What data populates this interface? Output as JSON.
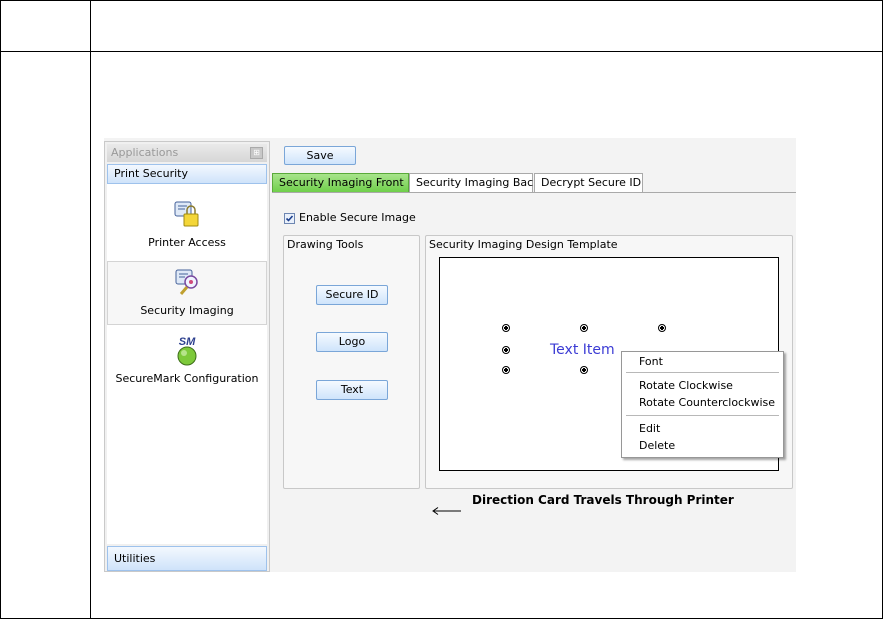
{
  "sidebar": {
    "header": "Applications",
    "sections": [
      "Print Security",
      "Utilities"
    ],
    "items": [
      {
        "label": "Printer Access",
        "icon": "lock-card-icon"
      },
      {
        "label": "Security Imaging",
        "icon": "magnifier-card-icon"
      },
      {
        "label": "SecureMark Configuration",
        "icon": "securemark-icon",
        "badge": "SM"
      }
    ]
  },
  "toolbar": {
    "save_label": "Save"
  },
  "tabs": [
    {
      "label": "Security Imaging Front",
      "active": true
    },
    {
      "label": "Security Imaging Back",
      "active": false
    },
    {
      "label": "Decrypt Secure ID",
      "active": false
    }
  ],
  "options": {
    "enable_secure_image_label": "Enable Secure Image",
    "enable_secure_image_checked": true
  },
  "drawing_tools": {
    "title": "Drawing Tools",
    "buttons": [
      "Secure ID",
      "Logo",
      "Text"
    ]
  },
  "template": {
    "title": "Security Imaging Design Template",
    "text_item": "Text Item"
  },
  "context_menu": {
    "items": [
      "Font",
      "Rotate Clockwise",
      "Rotate Counterclockwise",
      "Edit",
      "Delete"
    ]
  },
  "direction_note": "Direction Card Travels Through Printer",
  "colors": {
    "accent_tab": "#6fcf4a",
    "button": "#cfe4fb",
    "text_item": "#3b3bd4"
  }
}
